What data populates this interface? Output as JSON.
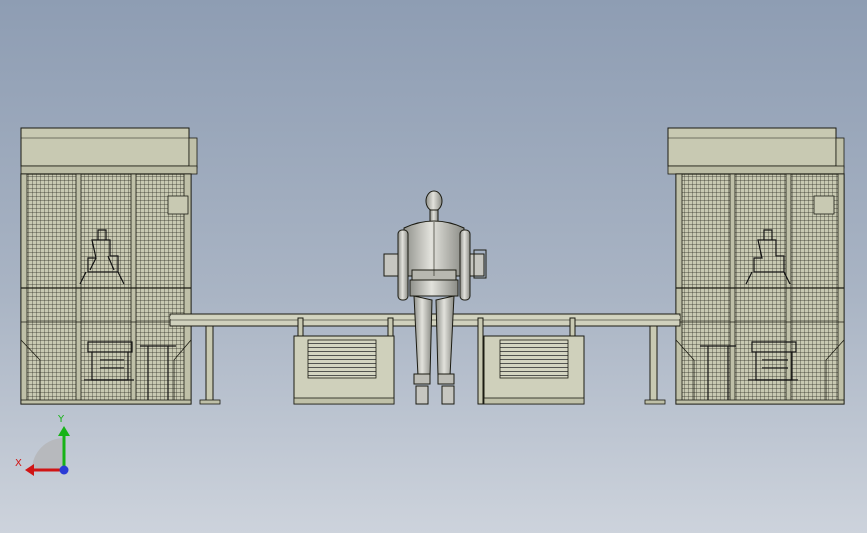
{
  "triad": {
    "y_label": "Y",
    "x_label": "X",
    "colors": {
      "x": "#d01515",
      "y": "#17b317",
      "z": "#2a3bd6"
    }
  },
  "colors": {
    "background_top": "#8e9db3",
    "background_bottom": "#cdd3dc",
    "machine_fill": "#c8c9b2",
    "machine_line": "#1b1b12",
    "robot_fill": "#c6c6c0"
  }
}
